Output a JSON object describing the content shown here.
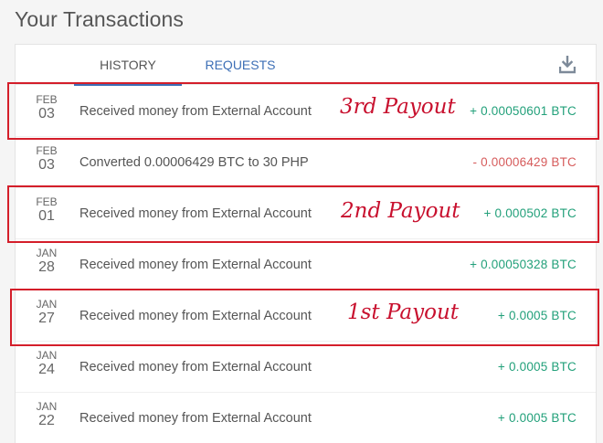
{
  "page": {
    "title": "Your Transactions"
  },
  "tabs": {
    "history": "HISTORY",
    "requests": "REQUESTS"
  },
  "icons": {
    "download": "download-icon"
  },
  "colors": {
    "positive": "#22a07a",
    "negative": "#d65b5b",
    "accent": "#3d6fb6",
    "highlight": "#d41e2a"
  },
  "transactions": [
    {
      "month": "FEB",
      "day": "03",
      "description": "Received money from External Account",
      "amount": "+ 0.00050601 BTC"
    },
    {
      "month": "FEB",
      "day": "03",
      "description": "Converted 0.00006429 BTC to 30 PHP",
      "amount": "- 0.00006429 BTC"
    },
    {
      "month": "FEB",
      "day": "01",
      "description": "Received money from External Account",
      "amount": "+ 0.000502 BTC"
    },
    {
      "month": "JAN",
      "day": "28",
      "description": "Received money from External Account",
      "amount": "+ 0.00050328 BTC"
    },
    {
      "month": "JAN",
      "day": "27",
      "description": "Received money from External Account",
      "amount": "+ 0.0005 BTC"
    },
    {
      "month": "JAN",
      "day": "24",
      "description": "Received money from External Account",
      "amount": "+ 0.0005 BTC"
    },
    {
      "month": "JAN",
      "day": "22",
      "description": "Received money from External Account",
      "amount": "+ 0.0005 BTC"
    }
  ],
  "annotations": [
    {
      "label": "3rd Payout"
    },
    {
      "label": "2nd Payout"
    },
    {
      "label": "1st Payout"
    }
  ]
}
